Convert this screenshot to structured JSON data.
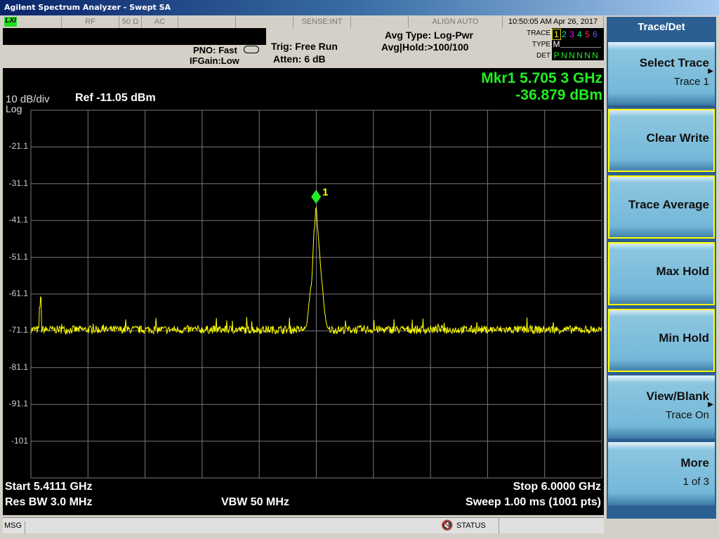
{
  "window": {
    "title": "Agilent Spectrum Analyzer - Swept SA"
  },
  "status": {
    "lxi": "LXI",
    "input": "RF",
    "impedance": "50 Ω",
    "coupling": "AC",
    "sense": "SENSE:INT",
    "align": "ALIGN AUTO",
    "datetime": "10:50:05 AM Apr 26, 2017"
  },
  "settings": {
    "pno": "PNO: Fast",
    "ifgain": "IFGain:Low",
    "trig": "Trig: Free Run",
    "atten": "Atten: 6 dB",
    "avg_type": "Avg Type: Log-Pwr",
    "avg_hold": "Avg|Hold:>100/100"
  },
  "trace_table": {
    "trace_label": "TRACE",
    "type_label": "TYPE",
    "det_label": "DET",
    "traces": [
      "1",
      "2",
      "3",
      "4",
      "5",
      "6"
    ],
    "trace_colors": [
      "#ffff00",
      "#00e0e0",
      "#ff00ff",
      "#00ff80",
      "#ff3060",
      "#6060ff"
    ],
    "type": "M",
    "det": [
      "P",
      "N",
      "N",
      "N",
      "N",
      "N"
    ]
  },
  "display": {
    "scale": "10 dB/div",
    "scale_type": "Log",
    "ref": "Ref -11.05 dBm",
    "marker_freq": "Mkr1 5.705 3 GHz",
    "marker_amp": "-36.879 dBm",
    "marker_label": "1",
    "start": "Start 5.4111 GHz",
    "stop": "Stop 6.0000 GHz",
    "rbw": "Res BW 3.0 MHz",
    "vbw": "VBW 50 MHz",
    "sweep": "Sweep  1.00 ms (1001 pts)"
  },
  "chart_data": {
    "type": "line",
    "x_range_ghz": [
      5.4111,
      6.0
    ],
    "y_range_dbm": [
      -111.05,
      -11.05
    ],
    "y_tick_labels": [
      "-21.1",
      "-31.1",
      "-41.1",
      "-51.1",
      "-61.1",
      "-71.1",
      "-81.1",
      "-91.1",
      "-101"
    ],
    "grid": true,
    "trace_color": "#ffff00",
    "noise_floor_dbm": -70.5,
    "features": [
      {
        "x": 5.4212,
        "y": -62
      },
      {
        "x": 5.42,
        "y": -64.5
      }
    ],
    "peak_profile": [
      [
        5.693,
        -70.5
      ],
      [
        5.696,
        -69
      ],
      [
        5.699,
        -61
      ],
      [
        5.701,
        -57
      ],
      [
        5.703,
        -45
      ],
      [
        5.7053,
        -36.9
      ],
      [
        5.7075,
        -45
      ],
      [
        5.7095,
        -52
      ],
      [
        5.7115,
        -58
      ],
      [
        5.714,
        -66
      ],
      [
        5.717,
        -70.5
      ]
    ],
    "marker": {
      "x": 5.7053,
      "y": -36.879
    }
  },
  "messages": {
    "msg": "MSG",
    "status": "STATUS"
  },
  "softkeys": {
    "title": "Trace/Det",
    "items": [
      {
        "label": "Select Trace",
        "sub": "Trace 1"
      },
      {
        "label": "Clear Write",
        "sub": ""
      },
      {
        "label": "Trace Average",
        "sub": ""
      },
      {
        "label": "Max Hold",
        "sub": ""
      },
      {
        "label": "Min Hold",
        "sub": ""
      },
      {
        "label": "View/Blank",
        "sub": "Trace On"
      },
      {
        "label": "More",
        "sub": "1 of 3"
      }
    ]
  }
}
